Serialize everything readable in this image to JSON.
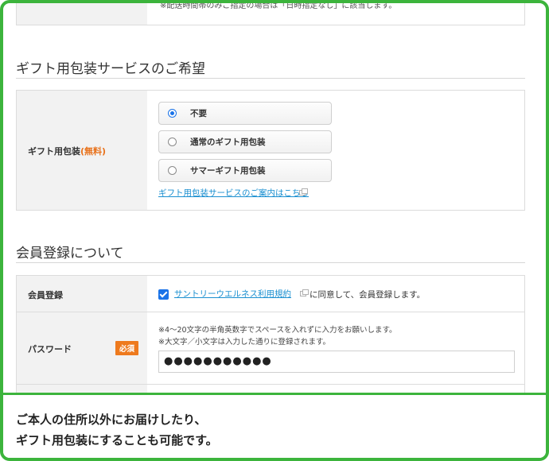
{
  "top_note": "※配送時間帯のみご指定の場合は「日時指定なし」に該当します。",
  "gift_section": {
    "title": "ギフト用包装サービスのご希望",
    "row_label": "ギフト用包装",
    "row_label_accent": "(無料)",
    "options": [
      {
        "label": "不要",
        "selected": true
      },
      {
        "label": "通常のギフト用包装",
        "selected": false
      },
      {
        "label": "サマーギフト用包装",
        "selected": false
      }
    ],
    "info_link": "ギフト用包装サービスのご案内はこちら"
  },
  "member_section": {
    "title": "会員登録について",
    "registration": {
      "label": "会員登録",
      "checked": true,
      "terms_link": "サントリーウエルネス利用規約",
      "agree_text": "に同意して、会員登録します。"
    },
    "password": {
      "label": "パスワード",
      "required_badge": "必須",
      "note1": "※4～20文字の半角英数字でスペースを入れずに入力をお願いします。",
      "note2": "※大文字／小文字は入力した通りに登録されます。",
      "value": "●●●●●●●●●●●"
    }
  },
  "caption": {
    "line1": "ご本人の住所以外にお届けしたり、",
    "line2": "ギフト用包装にすることも可能です。"
  },
  "colors": {
    "frame_green": "#3cb43c",
    "accent_orange": "#e8711a",
    "link_blue": "#1a8fd0",
    "check_blue": "#1a73e8"
  }
}
